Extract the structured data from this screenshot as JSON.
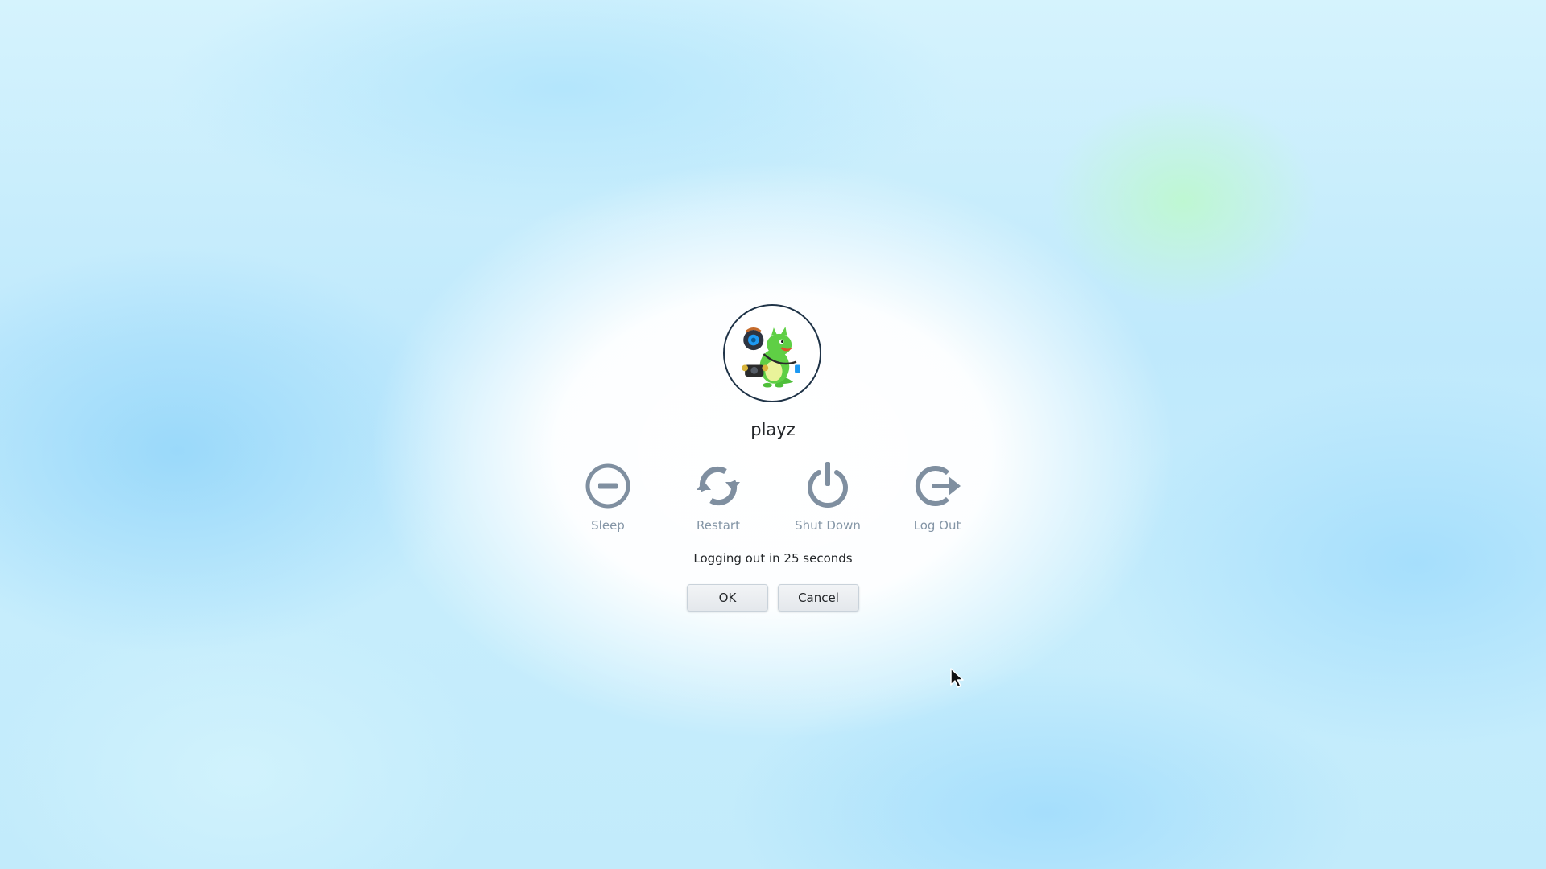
{
  "user": {
    "name": "playz",
    "avatar_icon": "konqi-dragon-avatar"
  },
  "actions": [
    {
      "label": "Sleep",
      "icon": "sleep-icon"
    },
    {
      "label": "Restart",
      "icon": "restart-icon"
    },
    {
      "label": "Shut Down",
      "icon": "shutdown-icon"
    },
    {
      "label": "Log Out",
      "icon": "logout-icon"
    }
  ],
  "countdown_text": "Logging out in 25 seconds",
  "buttons": {
    "ok_label": "OK",
    "cancel_label": "Cancel"
  },
  "colors": {
    "icon": "#7f8fa0",
    "label": "#8495a6",
    "text": "#232629",
    "avatar_border": "#1f3347"
  }
}
